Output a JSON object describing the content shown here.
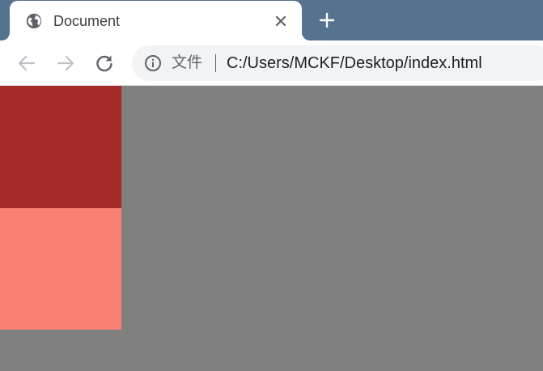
{
  "tab": {
    "title": "Document",
    "favicon": "globe-icon",
    "close_icon": "close-icon"
  },
  "new_tab_icon": "plus-icon",
  "toolbar": {
    "back_icon": "arrow-left-icon",
    "forward_icon": "arrow-right-icon",
    "reload_icon": "reload-icon"
  },
  "omnibox": {
    "info_icon": "info-icon",
    "security_label": "文件",
    "url": "C:/Users/MCKF/Desktop/index.html"
  },
  "colors": {
    "tabstrip": "#55728f",
    "page_background": "#808080",
    "box_dark": "#a52a2a",
    "box_light": "#fa8072"
  }
}
